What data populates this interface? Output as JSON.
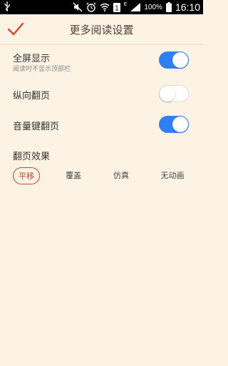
{
  "statusbar": {
    "usb_icon": "usb-icon",
    "battery_percent": "100%",
    "time": "16:10",
    "network_letter": "E",
    "sim_badge": "1"
  },
  "header": {
    "title": "更多阅读设置",
    "check_icon": "checkmark-icon",
    "accent_color": "#d9452a"
  },
  "settings": [
    {
      "label": "全屏显示",
      "sublabel": "阅读时不显示顶部栏",
      "on": true
    },
    {
      "label": "纵向翻页",
      "on": false
    },
    {
      "label": "音量键翻页",
      "on": true
    }
  ],
  "effects": {
    "title": "翻页效果",
    "options": [
      "平移",
      "覆盖",
      "仿真",
      "无动画"
    ],
    "selected": "平移"
  },
  "colors": {
    "background": "#fdf3e4",
    "toggle_on": "#2f7ff5",
    "selected_outline": "#c9442c"
  }
}
